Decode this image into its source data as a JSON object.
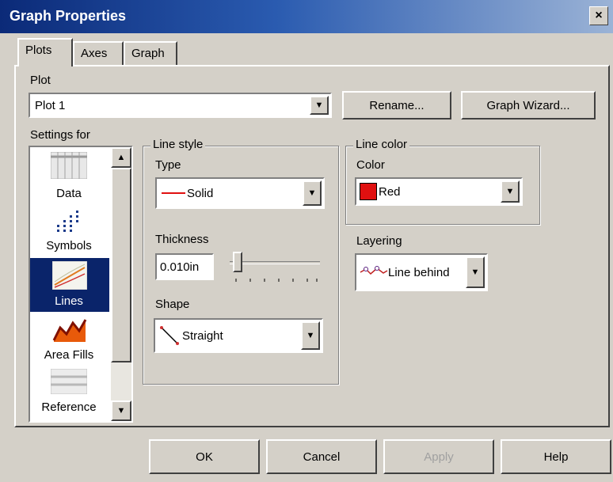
{
  "window": {
    "title": "Graph Properties",
    "close_glyph": "×"
  },
  "tabs": [
    {
      "label": "Plots",
      "active": true
    },
    {
      "label": "Axes",
      "active": false
    },
    {
      "label": "Graph",
      "active": false
    }
  ],
  "plot": {
    "label": "Plot",
    "selected": "Plot 1",
    "rename_label": "Rename...",
    "wizard_label": "Graph Wizard..."
  },
  "settings_for": {
    "label": "Settings for",
    "items": [
      {
        "label": "Data",
        "icon": "data-icon"
      },
      {
        "label": "Symbols",
        "icon": "symbols-icon"
      },
      {
        "label": "Lines",
        "icon": "lines-icon",
        "selected": true
      },
      {
        "label": "Area Fills",
        "icon": "area-fills-icon"
      },
      {
        "label": "Reference",
        "icon": "reference-icon"
      }
    ]
  },
  "line_style": {
    "group_label": "Line style",
    "type_label": "Type",
    "type_value": "Solid",
    "thickness_label": "Thickness",
    "thickness_value": "0.010in",
    "shape_label": "Shape",
    "shape_value": "Straight"
  },
  "line_color": {
    "group_label": "Line color",
    "color_label": "Color",
    "color_value": "Red",
    "swatch": "#e01010"
  },
  "layering": {
    "label": "Layering",
    "value": "Line behind"
  },
  "footer": {
    "ok_label": "OK",
    "cancel_label": "Cancel",
    "apply_label": "Apply",
    "help_label": "Help"
  },
  "colors": {
    "dialog_bg": "#d4d0c8",
    "title_start": "#0b2a78",
    "selection": "#0a246a"
  }
}
